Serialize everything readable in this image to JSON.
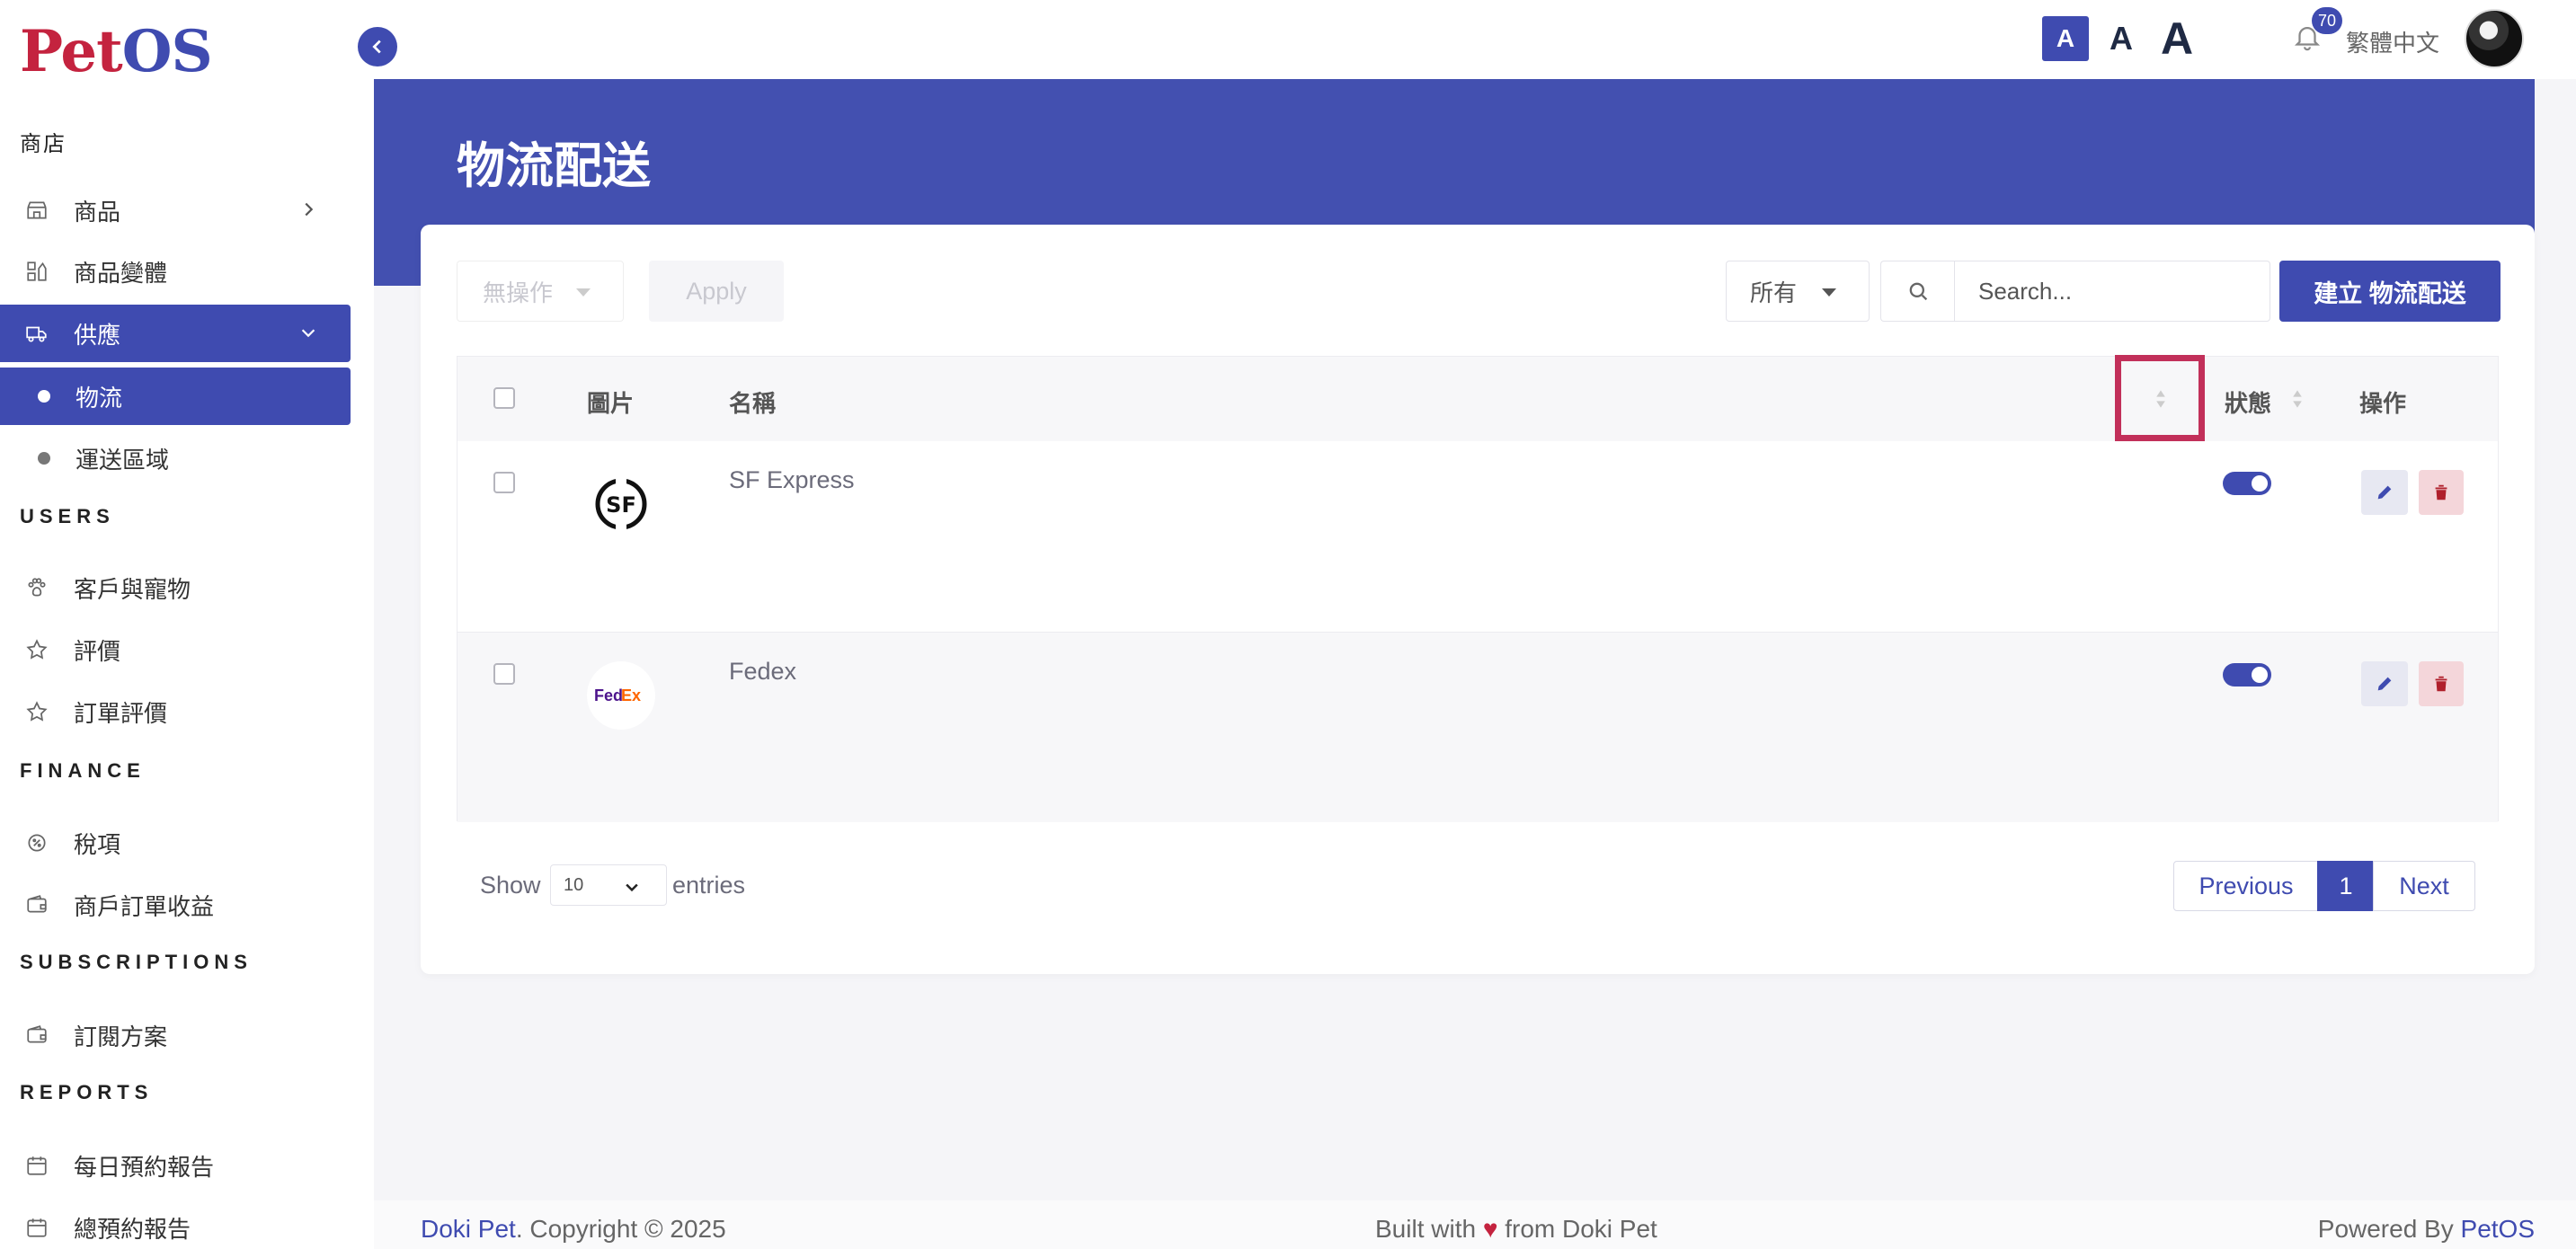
{
  "app": {
    "logo_pet": "Pet",
    "logo_os": "OS"
  },
  "sidebar": {
    "section_store": "商店",
    "items_store": [
      {
        "label": "商品",
        "icon": "store-icon"
      },
      {
        "label": "商品變體",
        "icon": "variant-icon"
      },
      {
        "label": "供應",
        "icon": "truck-icon"
      }
    ],
    "sub_items": [
      {
        "label": "物流"
      },
      {
        "label": "運送區域"
      }
    ],
    "section_users": "USERS",
    "items_users": [
      {
        "label": "客戶與寵物",
        "icon": "paw-icon"
      },
      {
        "label": "評價",
        "icon": "star-icon"
      },
      {
        "label": "訂單評價",
        "icon": "star-icon"
      }
    ],
    "section_finance": "FINANCE",
    "items_finance": [
      {
        "label": "稅項",
        "icon": "tax-icon"
      },
      {
        "label": "商戶訂單收益",
        "icon": "wallet-icon"
      }
    ],
    "section_subscriptions": "SUBSCRIPTIONS",
    "items_subscriptions": [
      {
        "label": "訂閱方案",
        "icon": "wallet-icon"
      }
    ],
    "section_reports": "REPORTS",
    "items_reports": [
      {
        "label": "每日預約報告",
        "icon": "calendar-icon"
      },
      {
        "label": "總預約報告",
        "icon": "calendar-icon"
      }
    ]
  },
  "topbar": {
    "font_small": "A",
    "font_medium": "A",
    "font_large": "A",
    "notification_count": "70",
    "language": "繁體中文"
  },
  "page": {
    "title": "物流配送"
  },
  "toolbar": {
    "bulk_action": "無操作",
    "apply_label": "Apply",
    "filter_value": "所有",
    "search_placeholder": "Search...",
    "create_label": "建立 物流配送"
  },
  "table": {
    "headers": {
      "image": "圖片",
      "name": "名稱",
      "status": "狀態",
      "actions": "操作"
    },
    "rows": [
      {
        "name": "SF Express",
        "logo_text": "SF",
        "status_on": true
      },
      {
        "name": "Fedex",
        "logo_text_a": "Fed",
        "logo_text_b": "Ex",
        "status_on": true
      }
    ]
  },
  "pagination": {
    "show_label": "Show",
    "page_size": "10",
    "entries_label": "entries",
    "previous": "Previous",
    "current": "1",
    "next": "Next"
  },
  "footer": {
    "left_brand": "Doki Pet",
    "left_text": ". Copyright © 2025",
    "mid_a": "Built with ",
    "mid_heart": "♥",
    "mid_b": " from Doki Pet",
    "right_text": "Powered By ",
    "right_brand": "PetOS"
  },
  "colors": {
    "primary": "#3f4bb0",
    "brand_red": "#c4233f",
    "highlight": "#c2305a"
  }
}
